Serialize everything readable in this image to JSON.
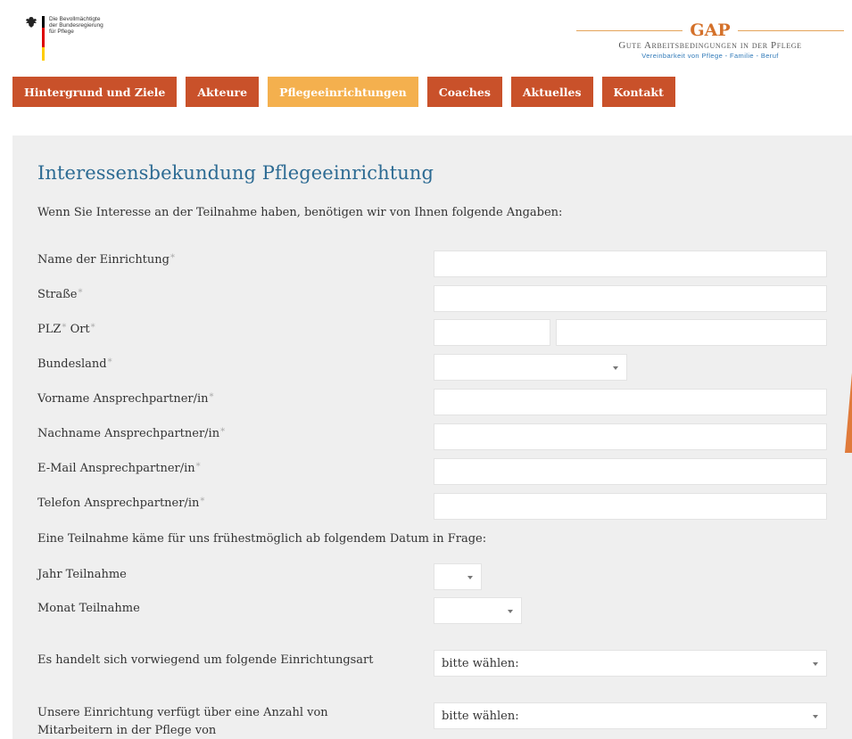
{
  "header": {
    "ministry": {
      "lines": [
        "Die Bevollmächtigte",
        "der Bundesregierung",
        "für Pflege"
      ]
    },
    "gap": {
      "title": "GAP",
      "subtitle": "Gute Arbeitsbedingungen in der Pflege",
      "tagline": "Vereinbarkeit von Pflege - Familie - Beruf"
    }
  },
  "nav": {
    "items": [
      {
        "label": "Hintergrund und Ziele"
      },
      {
        "label": "Akteure"
      },
      {
        "label": "Pflegeeinrichtungen",
        "active": true
      },
      {
        "label": "Coaches"
      },
      {
        "label": "Aktuelles"
      },
      {
        "label": "Kontakt"
      }
    ]
  },
  "form": {
    "title": "Interessensbekundung Pflegeeinrichtung",
    "intro": "Wenn Sie Interesse an der Teilnahme haben, benötigen wir von Ihnen folgende Angaben:",
    "required_mark": "*",
    "fields": {
      "name": {
        "label": "Name der Einrichtung",
        "value": ""
      },
      "street": {
        "label": "Straße",
        "value": ""
      },
      "plz": {
        "label": "PLZ",
        "value": ""
      },
      "ort": {
        "label": "Ort",
        "value": ""
      },
      "state": {
        "label": "Bundesland",
        "value": ""
      },
      "firstname": {
        "label": "Vorname Ansprechpartner/in",
        "value": ""
      },
      "lastname": {
        "label": "Nachname Ansprechpartner/in",
        "value": ""
      },
      "email": {
        "label": "E-Mail Ansprechpartner/in",
        "value": ""
      },
      "phone": {
        "label": "Telefon Ansprechpartner/in",
        "value": ""
      }
    },
    "date_note": "Eine Teilnahme käme für uns frühestmöglich ab folgendem Datum in Frage:",
    "year": {
      "label": "Jahr Teilnahme",
      "value": ""
    },
    "month": {
      "label": "Monat Teilnahme",
      "value": ""
    },
    "facility_type": {
      "label": "Es handelt sich vorwiegend um folgende Einrichtungsart",
      "value": "bitte wählen:"
    },
    "staff_count": {
      "label_line1": "Unsere Einrichtung verfügt über eine Anzahl von",
      "label_line2": "Mitarbeitern in der Pflege von",
      "value": "bitte wählen:"
    }
  },
  "colors": {
    "nav": "#c9512a",
    "nav_active": "#f4b04e",
    "title": "#2d6b93",
    "background": "#efefef"
  }
}
